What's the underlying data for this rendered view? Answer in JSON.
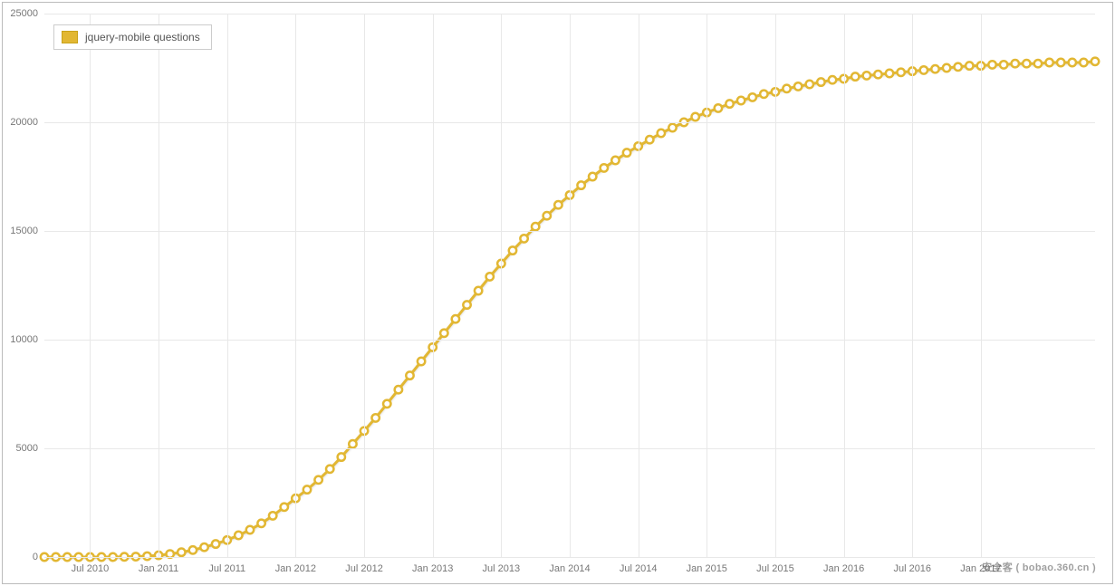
{
  "chart_data": {
    "type": "line",
    "title": "",
    "xlabel": "",
    "ylabel": "",
    "ylim": [
      0,
      25000
    ],
    "y_ticks": [
      0,
      5000,
      10000,
      15000,
      20000,
      25000
    ],
    "x_tick_labels": [
      "Jul 2010",
      "Jan 2011",
      "Jul 2011",
      "Jan 2012",
      "Jul 2012",
      "Jan 2013",
      "Jul 2013",
      "Jan 2014",
      "Jul 2014",
      "Jan 2015",
      "Jul 2015",
      "Jan 2016",
      "Jul 2016",
      "Jan 2017"
    ],
    "legend": [
      "jquery-mobile questions"
    ],
    "series": [
      {
        "name": "jquery-mobile questions",
        "color": "#e2b733",
        "x": [
          0,
          1,
          2,
          3,
          4,
          5,
          6,
          7,
          8,
          9,
          10,
          11,
          12,
          13,
          14,
          15,
          16,
          17,
          18,
          19,
          20,
          21,
          22,
          23,
          24,
          25,
          26,
          27,
          28,
          29,
          30,
          31,
          32,
          33,
          34,
          35,
          36,
          37,
          38,
          39,
          40,
          41,
          42,
          43,
          44,
          45,
          46,
          47,
          48,
          49,
          50,
          51,
          52,
          53,
          54,
          55,
          56,
          57,
          58,
          59,
          60,
          61,
          62,
          63,
          64,
          65,
          66,
          67,
          68,
          69,
          70,
          71,
          72,
          73,
          74,
          75,
          76,
          77,
          78,
          79,
          80,
          81,
          82,
          83,
          84,
          85,
          86,
          87,
          88,
          89,
          90,
          91,
          92
        ],
        "values": [
          0,
          0,
          0,
          0,
          0,
          0,
          0,
          10,
          20,
          40,
          80,
          140,
          220,
          320,
          450,
          600,
          780,
          1000,
          1250,
          1550,
          1900,
          2300,
          2700,
          3100,
          3550,
          4050,
          4600,
          5200,
          5800,
          6400,
          7050,
          7700,
          8350,
          9000,
          9650,
          10300,
          10950,
          11600,
          12250,
          12900,
          13500,
          14100,
          14650,
          15200,
          15700,
          16200,
          16650,
          17100,
          17500,
          17900,
          18250,
          18600,
          18900,
          19200,
          19500,
          19750,
          20000,
          20250,
          20450,
          20650,
          20850,
          21000,
          21150,
          21300,
          21400,
          21550,
          21650,
          21750,
          21850,
          21950,
          22000,
          22100,
          22150,
          22200,
          22250,
          22300,
          22350,
          22400,
          22450,
          22500,
          22550,
          22600,
          22600,
          22650,
          22650,
          22700,
          22700,
          22700,
          22750,
          22750,
          22750,
          22750,
          22800
        ]
      }
    ]
  },
  "legend_label": "jquery-mobile questions",
  "watermark": "安全客 ( bobao.360.cn )"
}
